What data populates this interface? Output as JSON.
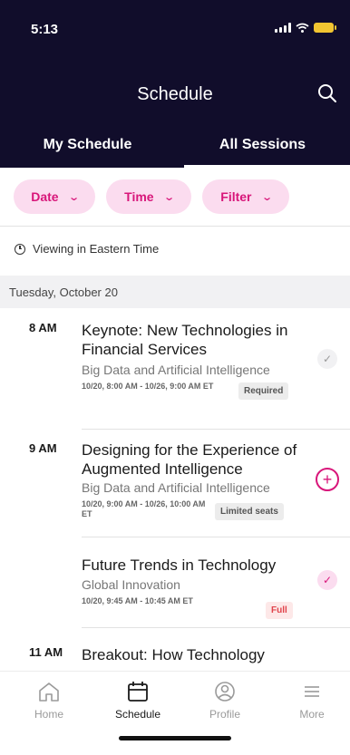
{
  "status_bar": {
    "time": "5:13"
  },
  "header": {
    "title": "Schedule"
  },
  "tabs": [
    {
      "label": "My Schedule"
    },
    {
      "label": "All Sessions"
    }
  ],
  "filters": [
    {
      "label": "Date"
    },
    {
      "label": "Time"
    },
    {
      "label": "Filter"
    }
  ],
  "timezone_note": "Viewing in Eastern Time",
  "day": "Tuesday, October 20",
  "sessions": [
    {
      "time": "8 AM",
      "title": "Keynote: New Technologies in Financial Services",
      "track": "Big Data and Artificial Intelligence",
      "datetime": "10/20, 8:00 AM - 10/26, 9:00 AM ET",
      "badge": "Required",
      "action": "check-grey"
    },
    {
      "time": "9 AM",
      "title": "Designing for the Experience of Augmented Intelligence",
      "track": "Big Data and Artificial Intelligence",
      "datetime": "10/20, 9:00 AM - 10/26, 10:00 AM ET",
      "badge": "Limited seats",
      "action": "add"
    },
    {
      "time": "",
      "title": "Future Trends in Technology",
      "track": "Global Innovation",
      "datetime": "10/20, 9:45 AM - 10:45 AM ET",
      "badge": "Full",
      "action": "check-pink"
    },
    {
      "time": "11 AM",
      "title": "Breakout: How Technology",
      "track": "",
      "datetime": "",
      "badge": "",
      "action": ""
    }
  ],
  "bottom_nav": [
    {
      "label": "Home",
      "icon": "home-icon"
    },
    {
      "label": "Schedule",
      "icon": "calendar-icon",
      "active": true
    },
    {
      "label": "Profile",
      "icon": "profile-icon"
    },
    {
      "label": "More",
      "icon": "menu-icon"
    }
  ],
  "colors": {
    "header_bg": "#110d2b",
    "accent": "#d8167a",
    "chip_bg": "#fbdcef"
  }
}
